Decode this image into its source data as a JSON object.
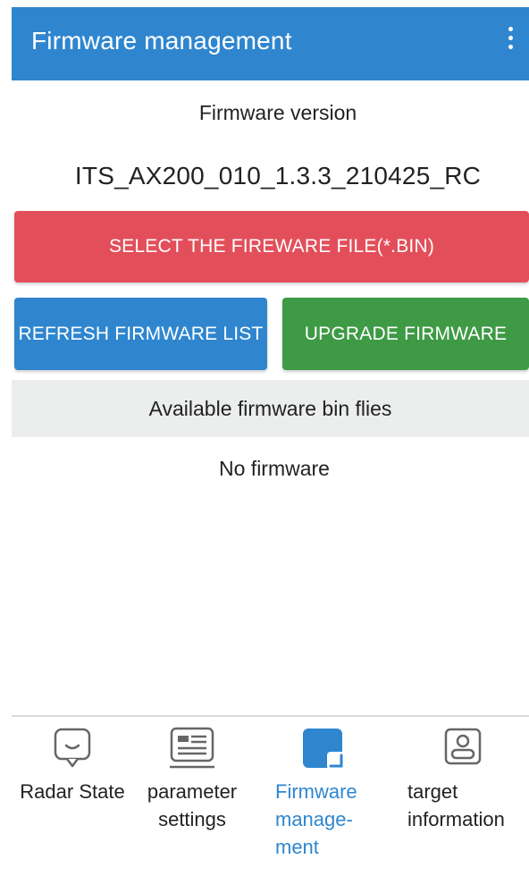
{
  "appbar": {
    "title": "Firmware management",
    "overflow_icon": "more-vert-icon"
  },
  "firmware": {
    "version_label": "Firmware version",
    "version_value": "ITS_AX200_010_1.3.3_210425_RC"
  },
  "buttons": {
    "select_file": "SELECT THE FIREWARE FILE(*.BIN)",
    "refresh_list": "REFRESH FIRMWARE LIST",
    "upgrade": "UPGRADE FIRMWARE"
  },
  "list": {
    "header": "Available firmware bin flies",
    "empty_text": "No firmware"
  },
  "bottom_nav": {
    "items": [
      {
        "line1": "Radar State",
        "line2": "",
        "line3": "",
        "icon": "message-bubble-icon",
        "active": false
      },
      {
        "line1": "parameter",
        "line2": "settings",
        "line3": "",
        "icon": "parameter-card-icon",
        "active": false
      },
      {
        "line1": "Firmware",
        "line2": "manage-",
        "line3": "ment",
        "icon": "firmware-tile-icon",
        "active": true
      },
      {
        "line1": "target",
        "line2": "information",
        "line3": "",
        "icon": "person-card-icon",
        "active": false
      }
    ]
  },
  "colors": {
    "primary_blue": "#2f86cf",
    "red": "#e24f5a",
    "green": "#3e9a45",
    "list_header_bg": "#eceeee"
  }
}
